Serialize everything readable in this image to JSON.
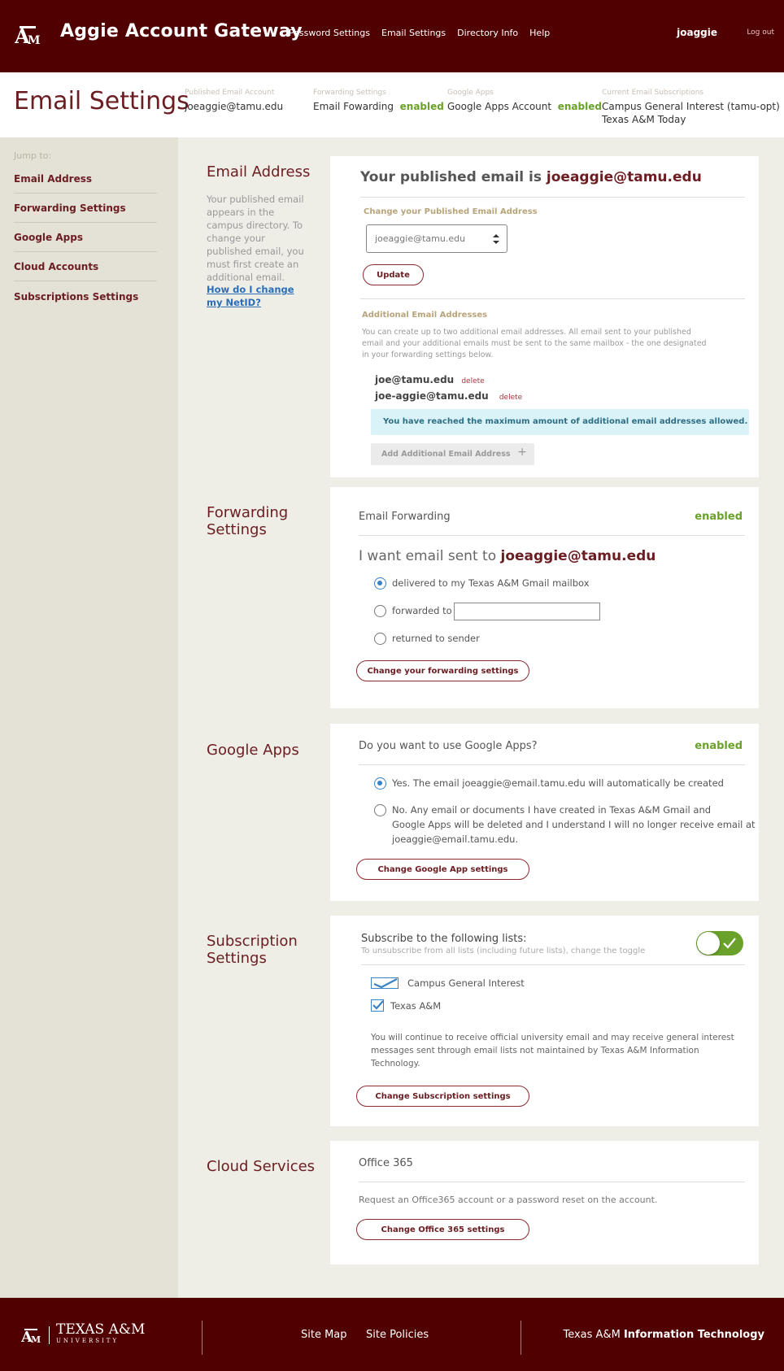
{
  "header": {
    "app_title": "Aggie Account Gateway",
    "nav": [
      "Password Settings",
      "Email Settings",
      "Directory Info",
      "Help"
    ],
    "username": "joaggie",
    "logout": "Log out"
  },
  "summary": {
    "page_title": "Email Settings",
    "published": {
      "label": "Published Email Account",
      "value": "joeaggie@tamu.edu"
    },
    "forwarding": {
      "label": "Forwarding Settings",
      "value": "Email Fowarding",
      "status": "enabled"
    },
    "google": {
      "label": "Google Apps",
      "value": "Google Apps Account",
      "status": "enabled"
    },
    "subscriptions": {
      "label": "Current Email Subscriptions",
      "line1": "Campus General Interest (tamu-opt)",
      "line2": "Texas A&M Today"
    }
  },
  "sidebar": {
    "jump": "Jump to:",
    "items": [
      "Email Address",
      "Forwarding Settings",
      "Google Apps",
      "Cloud Accounts",
      "Subscriptions Settings"
    ]
  },
  "email_address": {
    "title": "Email Address",
    "desc": "Your published email appears in the campus directory. To change your published email, you must first create an additional email.",
    "link": "How do I change my NetID?",
    "heading_prefix": "Your published email is ",
    "heading_email": "joeaggie@tamu.edu",
    "change_label": "Change your Published Email Address",
    "select_value": "joeaggie@tamu.edu",
    "update_btn": "Update",
    "additional_label": "Additional Email Addresses",
    "additional_desc": "You can create up to two additional email addresses. All email sent to your published email and your additional emails must be sent to the same mailbox - the one designated in your forwarding settings below.",
    "addresses": [
      {
        "email": "joe@tamu.edu",
        "action": "delete"
      },
      {
        "email": "joe-aggie@tamu.edu",
        "action": "delete"
      }
    ],
    "max_notice": "You have reached the maximum amount of additional email addresses allowed.",
    "add_btn": "Add Additional Email Address",
    "add_icon": "+"
  },
  "forwarding": {
    "title_l1": "Forwarding",
    "title_l2": "Settings",
    "card_label": "Email Forwarding",
    "status": "enabled",
    "want_prefix": "I want email sent to ",
    "want_email": "joeaggie@tamu.edu",
    "options": [
      "delivered to my Texas A&M Gmail mailbox",
      "forwarded to",
      "returned to sender"
    ],
    "forward_value": "",
    "btn": "Change your forwarding settings"
  },
  "google_apps": {
    "title": "Google Apps",
    "question": "Do you want to use Google Apps?",
    "status": "enabled",
    "yes": "Yes. The email joeaggie@email.tamu.edu will automatically be created",
    "no_l1": "No. Any email or documents I have created in Texas A&M Gmail and",
    "no_l2": "Google Apps will be deleted and I understand I will no longer receive email at",
    "no_l3": "joeaggie@email.tamu.edu.",
    "btn": "Change Google App settings"
  },
  "subscriptions": {
    "title_l1": "Subscription",
    "title_l2": "Settings",
    "heading": "Subscribe to the following lists:",
    "sub": "To unsubscribe from all lists (including future lists), change the toggle",
    "lists": [
      "Campus General Interest",
      "Texas A&M"
    ],
    "note": "You will continue to receive official university email and may receive general interest messages sent through email lists not maintained by Texas A&M Information Technology.",
    "btn": "Change Subscription settings"
  },
  "cloud": {
    "title": "Cloud Services",
    "service": "Office 365",
    "desc": "Request an Office365 account or a password reset on the account.",
    "btn": "Change Office 365 settings"
  },
  "footer": {
    "logo_text": "TEXAS A&M",
    "logo_sub": "UNIVERSITY",
    "links": [
      "Site Map",
      "Site Policies"
    ],
    "it_prefix": "Texas A&M ",
    "it_bold": "Information Technology"
  },
  "colors": {
    "maroon": "#500000",
    "accent": "#6b1d22",
    "enabled": "#6aa12a",
    "info_bg": "#d9f3f8"
  }
}
